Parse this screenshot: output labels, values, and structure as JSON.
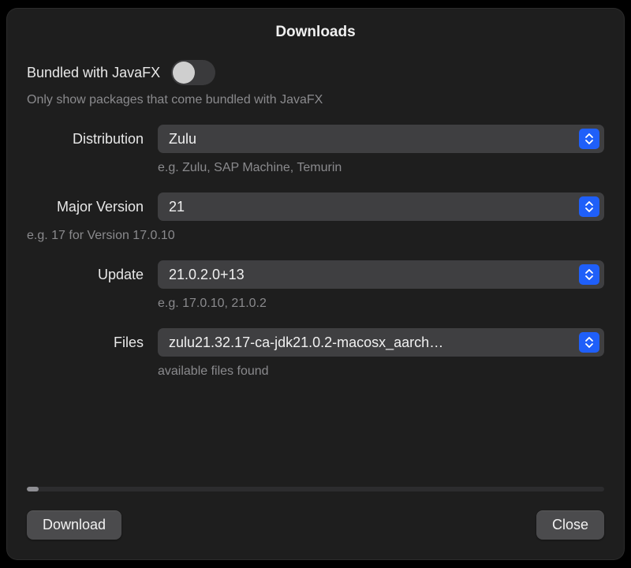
{
  "title": "Downloads",
  "javafx": {
    "label": "Bundled with JavaFX",
    "enabled": false,
    "hint": "Only show packages that come bundled with JavaFX"
  },
  "distribution": {
    "label": "Distribution",
    "value": "Zulu",
    "hint": "e.g. Zulu, SAP Machine, Temurin"
  },
  "majorVersion": {
    "label": "Major Version",
    "value": "21",
    "hint": "e.g. 17 for Version 17.0.10"
  },
  "update": {
    "label": "Update",
    "value": "21.0.2.0+13",
    "hint": "e.g. 17.0.10, 21.0.2"
  },
  "files": {
    "label": "Files",
    "value": "zulu21.32.17-ca-jdk21.0.2-macosx_aarch…",
    "hint": "available files found"
  },
  "buttons": {
    "download": "Download",
    "close": "Close"
  }
}
